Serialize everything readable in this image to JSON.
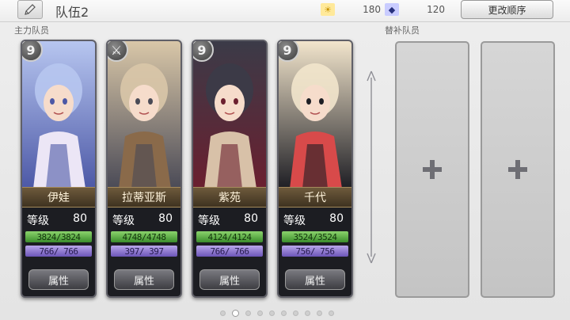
{
  "header": {
    "team_name": "队伍2",
    "resource_gold": {
      "icon": "gold-gem-icon",
      "glyph": "☀",
      "value": "180"
    },
    "resource_blue": {
      "icon": "blue-gem-icon",
      "glyph": "◆",
      "value": "120"
    },
    "change_order_label": "更改顺序"
  },
  "sections": {
    "main_label": "主力队员",
    "sub_label": "替补队员"
  },
  "cards": [
    {
      "name": "伊娃",
      "badge": "9",
      "level_label": "等级",
      "level": "80",
      "hp": "3824/3824",
      "mp": "766/ 766",
      "attr_label": "属性",
      "palette": [
        "#b7c6f0",
        "#ece6f6",
        "#4c58a6"
      ]
    },
    {
      "name": "拉蒂亚斯",
      "badge": "⚔",
      "level_label": "等级",
      "level": "80",
      "hp": "4748/4748",
      "mp": "397/ 397",
      "attr_label": "属性",
      "palette": [
        "#d9c7a8",
        "#8a6a4a",
        "#4a4a56"
      ]
    },
    {
      "name": "紫苑",
      "badge": "9",
      "level_label": "等级",
      "level": "80",
      "hp": "4124/4124",
      "mp": "766/ 766",
      "attr_label": "属性",
      "palette": [
        "#3b3b48",
        "#d8c1a8",
        "#6b1f2f"
      ]
    },
    {
      "name": "千代",
      "badge": "9",
      "level_label": "等级",
      "level": "80",
      "hp": "3524/3524",
      "mp": "756/ 756",
      "attr_label": "属性",
      "palette": [
        "#f2e5cc",
        "#d84a4a",
        "#1e1e24"
      ]
    }
  ],
  "empty_slots": [
    {
      "icon": "plus-icon"
    },
    {
      "icon": "plus-icon"
    }
  ],
  "pager": {
    "total": 10,
    "active": 1
  }
}
